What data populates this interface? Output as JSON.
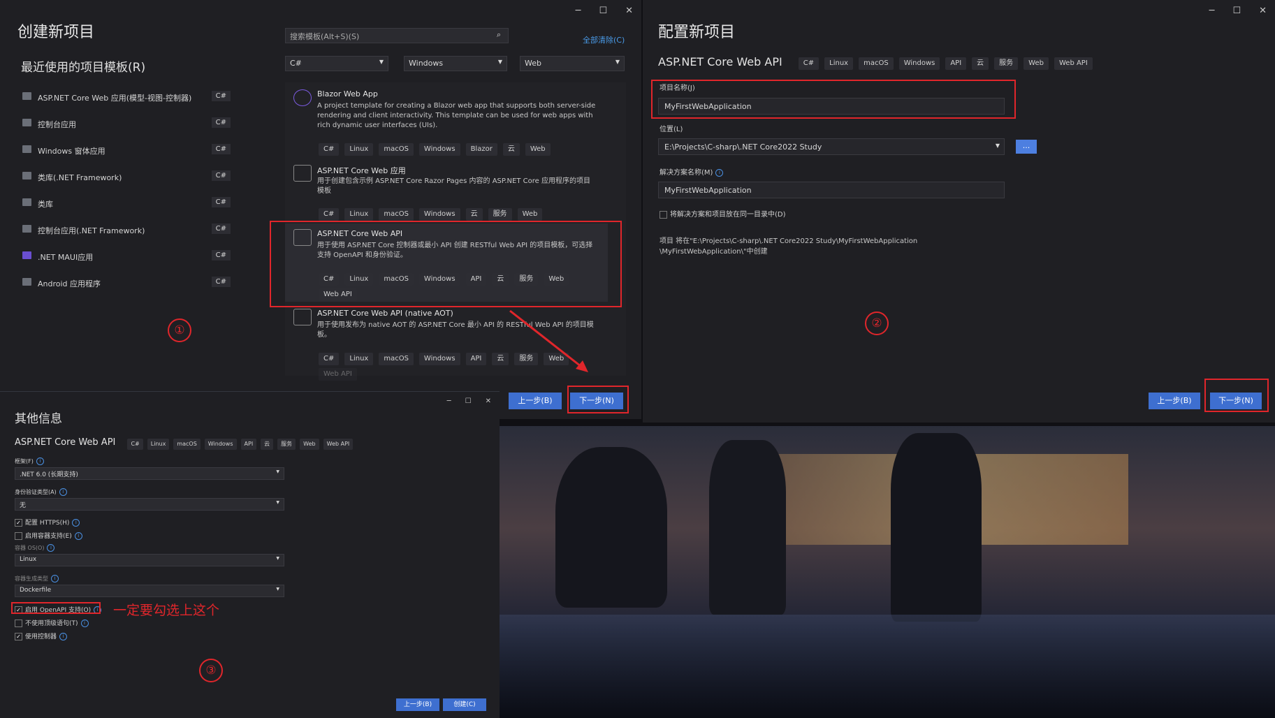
{
  "win1": {
    "title": "创建新项目",
    "recent_heading": "最近使用的项目模板(R)",
    "search_placeholder": "搜索模板(Alt+S)(S)",
    "clear_all": "全部清除(C)",
    "filters": {
      "language": "C#",
      "platform": "Windows",
      "type": "Web"
    },
    "recent": [
      {
        "label": "ASP.NET Core Web 应用(模型-视图-控制器)",
        "lang": "C#"
      },
      {
        "label": "控制台应用",
        "lang": "C#"
      },
      {
        "label": "Windows 窗体应用",
        "lang": "C#"
      },
      {
        "label": "类库(.NET Framework)",
        "lang": "C#"
      },
      {
        "label": "类库",
        "lang": "C#"
      },
      {
        "label": "控制台应用(.NET Framework)",
        "lang": "C#"
      },
      {
        "label": ".NET MAUI应用",
        "lang": "C#"
      },
      {
        "label": "Android 应用程序",
        "lang": "C#"
      }
    ],
    "templates": [
      {
        "title": "Blazor Web App",
        "desc": "A project template for creating a Blazor web app that supports both server-side rendering and client interactivity. This template can be used for web apps with rich dynamic user interfaces (UIs).",
        "tags": [
          "C#",
          "Linux",
          "macOS",
          "Windows",
          "Blazor",
          "云",
          "Web"
        ]
      },
      {
        "title": "ASP.NET Core Web 应用",
        "desc": "用于创建包含示例 ASP.NET Core Razor Pages 内容的 ASP.NET Core 应用程序的项目模板",
        "tags": [
          "C#",
          "Linux",
          "macOS",
          "Windows",
          "云",
          "服务",
          "Web"
        ]
      },
      {
        "title": "ASP.NET Core Web API",
        "desc": "用于使用 ASP.NET Core 控制器或最小 API 创建 RESTful Web API 的项目模板，可选择支持 OpenAPI 和身份验证。",
        "tags": [
          "C#",
          "Linux",
          "macOS",
          "Windows",
          "API",
          "云",
          "服务",
          "Web"
        ],
        "tags2": [
          "Web API"
        ]
      },
      {
        "title": "ASP.NET Core Web API (native AOT)",
        "desc": "用于使用发布为 native AOT 的 ASP.NET Core 最小 API 的 RESTful Web API 的项目模板。",
        "tags": [
          "C#",
          "Linux",
          "macOS",
          "Windows",
          "API",
          "云",
          "服务",
          "Web"
        ],
        "tags2": [
          "Web API"
        ]
      }
    ],
    "back_label": "上一步(B)",
    "next_label": "下一步(N)",
    "step_marker": "①"
  },
  "win2": {
    "title": "配置新项目",
    "project_type": "ASP.NET Core Web API",
    "tags": [
      "C#",
      "Linux",
      "macOS",
      "Windows",
      "API",
      "云",
      "服务",
      "Web",
      "Web API"
    ],
    "name_label": "项目名称(J)",
    "name_value": "MyFirstWebApplication",
    "location_label": "位置(L)",
    "location_value": "E:\\Projects\\C-sharp\\.NET Core2022 Study",
    "browse_label": "...",
    "solution_label": "解决方案名称(M)",
    "solution_value": "MyFirstWebApplication",
    "same_dir_label": "将解决方案和项目放在同一目录中(D)",
    "path_note_1": "项目 将在\"E:\\Projects\\C-sharp\\.NET Core2022 Study\\MyFirstWebApplication",
    "path_note_2": "\\MyFirstWebApplication\\\"中创建",
    "back_label": "上一步(B)",
    "next_label": "下一步(N)",
    "step_marker": "②"
  },
  "win3": {
    "title": "其他信息",
    "project_type": "ASP.NET Core Web API",
    "tags": [
      "C#",
      "Linux",
      "macOS",
      "Windows",
      "API",
      "云",
      "服务",
      "Web",
      "Web API"
    ],
    "framework_label": "框架(F)",
    "framework_value": ".NET 6.0 (长期支持)",
    "auth_label": "身份验证类型(A)",
    "auth_value": "无",
    "https_label": "配置 HTTPS(H)",
    "docker_label": "启用容器支持(E)",
    "os_label": "容器 OS(O)",
    "os_value": "Linux",
    "container_build_label": "容器生成类型",
    "container_build_value": "Dockerfile",
    "openapi_label": "启用 OpenAPI 支持(O)",
    "toplevel_label": "不使用顶级语句(T)",
    "controllers_label": "使用控制器",
    "annotation": "一定要勾选上这个",
    "back_label": "上一步(B)",
    "create_label": "创建(C)",
    "step_marker": "③"
  },
  "window_controls": {
    "minimize": "─",
    "maximize": "☐",
    "close": "✕"
  }
}
